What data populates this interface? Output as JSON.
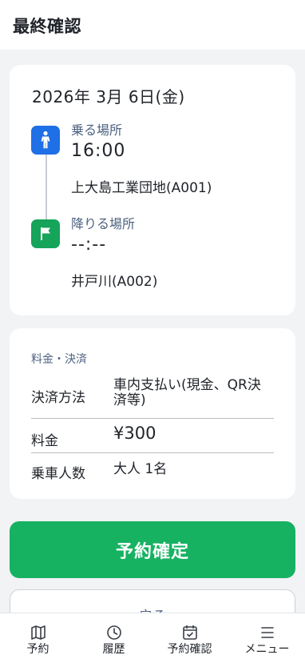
{
  "header": {
    "title": "最終確認"
  },
  "trip": {
    "date": "2026年 3月 6日(金)",
    "pickup": {
      "label": "乗る場所",
      "time": "16:00",
      "place": "上大島工業団地(A001)",
      "icon": "person-icon"
    },
    "dropoff": {
      "label": "降りる場所",
      "time": "--:--",
      "place": "井戸川(A002)",
      "icon": "flag-icon"
    }
  },
  "payment": {
    "title": "料金・決済",
    "rows": [
      {
        "label": "決済方法",
        "value_line1": "車内支払い(現金、QR決",
        "value_line2": "済等)"
      },
      {
        "label": "料金",
        "value": "¥300"
      },
      {
        "label": "乗車人数",
        "value": "大人 1名"
      }
    ]
  },
  "actions": {
    "confirm_label": "予約確定",
    "back_label": "戻る"
  },
  "tabs": [
    {
      "label": "予約",
      "icon": "map-icon"
    },
    {
      "label": "履歴",
      "icon": "clock-icon"
    },
    {
      "label": "予約確認",
      "icon": "calendar-check-icon"
    },
    {
      "label": "メニュー",
      "icon": "menu-icon"
    }
  ],
  "colors": {
    "accent_green": "#16b262",
    "pickup_blue": "#1f6fe6",
    "dropoff_green": "#16a35a"
  }
}
